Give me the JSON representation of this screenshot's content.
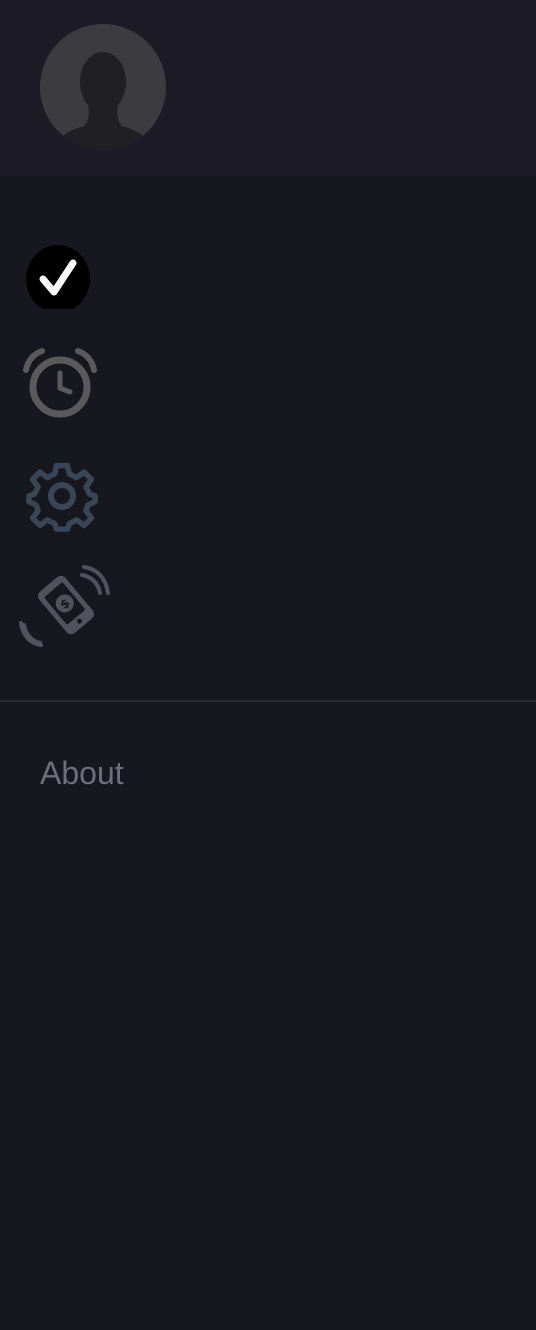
{
  "header": {
    "avatar_icon": "user-avatar-placeholder-icon"
  },
  "nav": {
    "items": [
      {
        "id": "tasks",
        "icon": "check-circle-icon",
        "active": true
      },
      {
        "id": "alarm",
        "icon": "alarm-clock-icon",
        "active": false
      },
      {
        "id": "settings",
        "icon": "gear-icon",
        "active": false
      },
      {
        "id": "payment",
        "icon": "mobile-payment-icon",
        "active": false
      }
    ]
  },
  "footer": {
    "about_label": "About"
  },
  "colors": {
    "background": "#171720",
    "header_background": "#1c1b26",
    "avatar": "#3c3c40",
    "check_badge": "#000000",
    "check_mark": "#ffffff",
    "alarm_icon": "#5a5a5c",
    "gear_icon": "#3a4556",
    "payment_icon": "#52525e",
    "about_text": "#6f6f7c",
    "divider": "#2b2b38"
  }
}
